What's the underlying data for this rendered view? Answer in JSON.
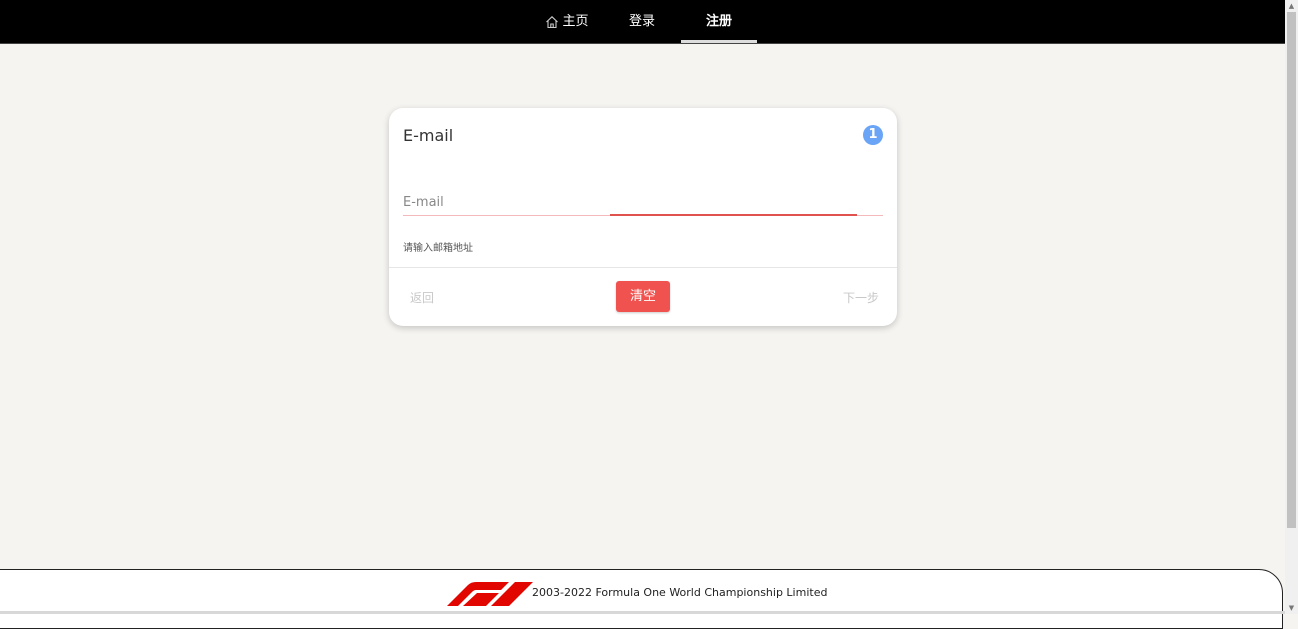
{
  "nav": {
    "home_label": "主页",
    "login_label": "登录",
    "register_label": "注册",
    "home_icon": "home-icon"
  },
  "card": {
    "title": "E-mail",
    "step": "1",
    "step_color": "#69a4f6",
    "field_label": "E-mail",
    "field_value": "",
    "helper": "请输入邮箱地址",
    "back_label": "返回",
    "clear_label": "清空",
    "next_label": "下一步",
    "accent_color": "#f0534f"
  },
  "footer": {
    "copyright": "2003-2022 Formula One World Championship Limited",
    "logo": "f1-logo"
  }
}
